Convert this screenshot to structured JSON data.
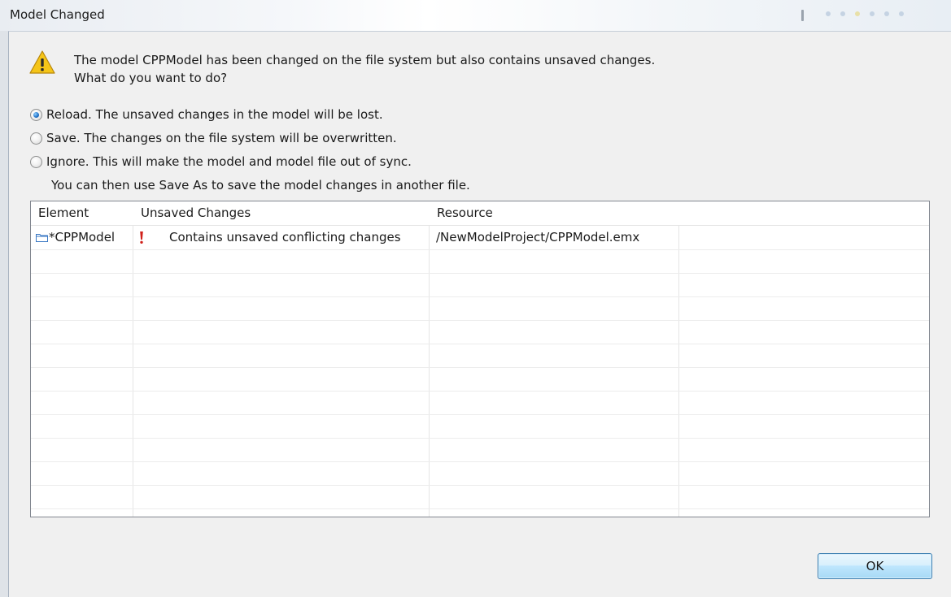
{
  "window": {
    "title": "Model Changed"
  },
  "message": {
    "line1": "The model CPPModel has been changed on the file system but also contains unsaved changes.",
    "line2": "What do you want to do?"
  },
  "options": [
    {
      "label": "Reload. The unsaved changes in the model will be lost.",
      "selected": true
    },
    {
      "label": "Save. The changes on the file system will be overwritten.",
      "selected": false
    },
    {
      "label": "Ignore. This will make the model and model file out of sync.",
      "selected": false
    }
  ],
  "hint": "You can then use Save As to save the model changes in another file.",
  "table": {
    "columns": [
      "Element",
      "Unsaved Changes",
      "Resource",
      ""
    ],
    "rows": [
      {
        "element": "*CPPModel",
        "element_icon": "folder-icon",
        "change": "Contains unsaved conflicting changes",
        "change_icon": "exclamation-icon",
        "resource": "/NewModelProject/CPPModel.emx"
      }
    ]
  },
  "buttons": {
    "ok": "OK"
  },
  "colors": {
    "warning": "#f5c518",
    "error": "#d0201a",
    "folder": "#3a78c4",
    "selected_radio": "#1f6fc6"
  }
}
